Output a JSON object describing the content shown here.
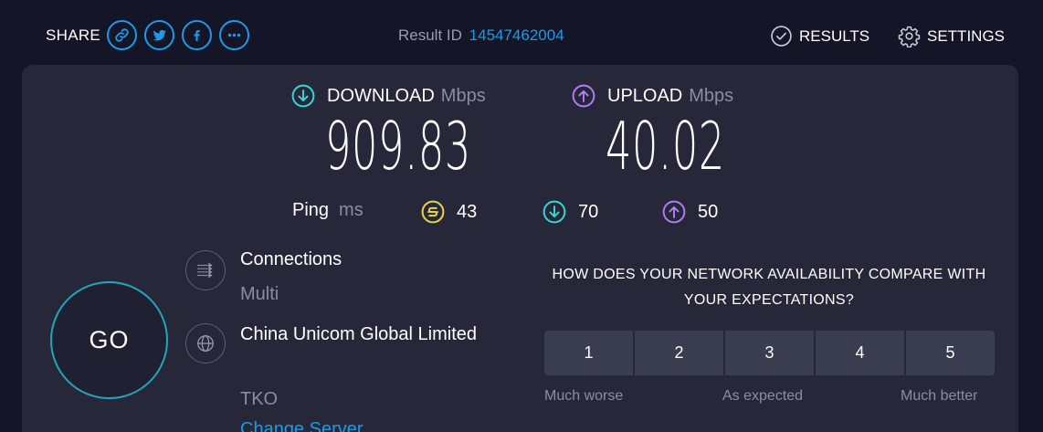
{
  "header": {
    "share_label": "SHARE",
    "share_buttons": [
      {
        "icon": "link-icon"
      },
      {
        "icon": "twitter-icon"
      },
      {
        "icon": "facebook-icon"
      },
      {
        "icon": "more-icon"
      }
    ],
    "result_label": "Result ID",
    "result_id": "14547462004",
    "results_label": "RESULTS",
    "settings_label": "SETTINGS"
  },
  "download": {
    "label": "DOWNLOAD",
    "unit": "Mbps",
    "value": "909.83",
    "color": "#3ad6d4"
  },
  "upload": {
    "label": "UPLOAD",
    "unit": "Mbps",
    "value": "40.02",
    "color": "#b57bf2"
  },
  "ping": {
    "label": "Ping",
    "unit": "ms",
    "idle": "43",
    "download": "70",
    "upload": "50",
    "idle_color": "#e8d24a"
  },
  "go_label": "GO",
  "server": {
    "connections_label": "Connections",
    "connections_value": "Multi",
    "host_name": "China Unicom Global Limited",
    "host_location": "TKO",
    "change_label": "Change Server"
  },
  "survey": {
    "question": "HOW DOES YOUR NETWORK AVAILABILITY COMPARE WITH YOUR EXPECTATIONS?",
    "options": [
      "1",
      "2",
      "3",
      "4",
      "5"
    ],
    "scale": [
      "Much worse",
      "As expected",
      "Much better"
    ]
  },
  "colors": {
    "background": "#141526",
    "panel": "#26283a",
    "accent": "#1d9ae8",
    "go_ring": "#23a5b8"
  }
}
